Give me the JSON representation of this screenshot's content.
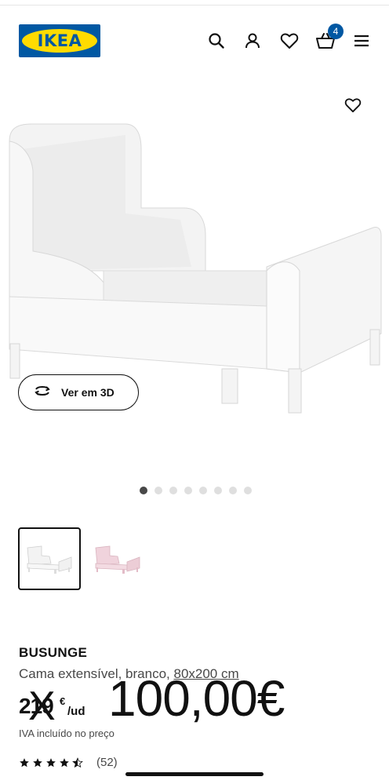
{
  "header": {
    "logo_text": "IKEA",
    "cart_count": "4",
    "icons": [
      "search-icon",
      "user-icon",
      "heart-icon",
      "cart-icon",
      "menu-icon"
    ]
  },
  "gallery": {
    "view_3d_label": "Ver em 3D",
    "dots_total": 8,
    "dots_active_index": 0,
    "variants": [
      {
        "name": "branco",
        "color": "#ffffff",
        "selected": true
      },
      {
        "name": "rosa",
        "color": "#f2d6de",
        "selected": false
      }
    ]
  },
  "product": {
    "name": "BUSUNGE",
    "description": "Cama extensível, branco, ",
    "dimensions": "80x200 cm",
    "old_price_int": "219",
    "old_price_currency": "€",
    "old_price_unit": "/ud",
    "old_price_mark": "X",
    "new_price": "100,00€",
    "vat_note": "IVA incluído no preço",
    "rating_value": 4.5,
    "rating_count": "(52)"
  },
  "colors": {
    "brand_blue": "#0058A3",
    "brand_yellow": "#FFDB00",
    "text": "#111111",
    "muted": "#484848"
  }
}
